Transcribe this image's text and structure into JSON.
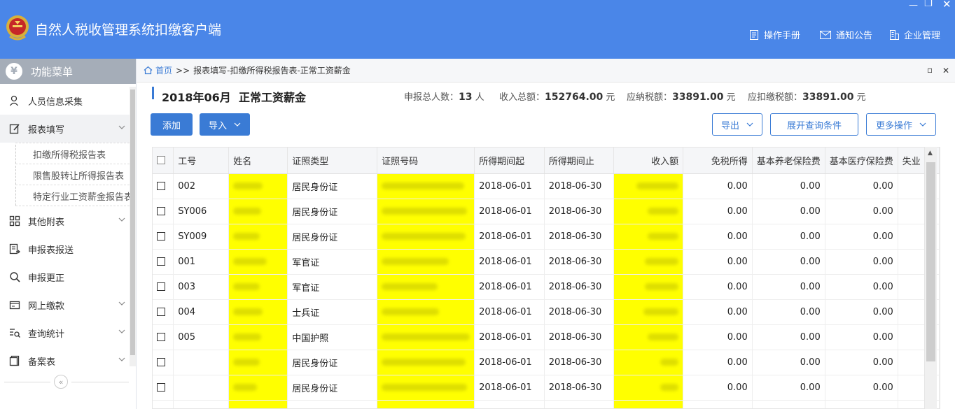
{
  "app": {
    "title": "自然人税收管理系统扣缴客户端"
  },
  "header_menu": [
    {
      "label": "操作手册",
      "icon": "manual-icon"
    },
    {
      "label": "通知公告",
      "icon": "mail-icon"
    },
    {
      "label": "企业管理",
      "icon": "building-icon"
    }
  ],
  "sidebar": {
    "title": "功能菜单",
    "items": [
      {
        "label": "人员信息采集",
        "icon": "person-icon"
      },
      {
        "label": "报表填写",
        "icon": "edit-icon",
        "expanded": true,
        "children": [
          "扣缴所得税报告表",
          "限售股转让所得报告表",
          "特定行业工资薪金报告表"
        ]
      },
      {
        "label": "其他附表",
        "icon": "grid-icon"
      },
      {
        "label": "申报表报送",
        "icon": "report-send-icon"
      },
      {
        "label": "申报更正",
        "icon": "search-icon"
      },
      {
        "label": "网上缴款",
        "icon": "wallet-icon"
      },
      {
        "label": "查询统计",
        "icon": "query-icon"
      },
      {
        "label": "备案表",
        "icon": "file-icon"
      }
    ],
    "collapse_symbol": "«"
  },
  "breadcrumb": {
    "home": "首页",
    "separator": ">>",
    "path": "报表填写-扣缴所得税报告表-正常工资薪金"
  },
  "summary": {
    "period": "2018年06月  正常工资薪金",
    "total_people_label": "申报总人数：",
    "total_people_value": "13",
    "total_people_unit": "人",
    "income_total_label": "收入总额：",
    "income_total_value": "152764.00",
    "income_total_unit": "元",
    "tax_payable_label": "应纳税额：",
    "tax_payable_value": "33891.00",
    "tax_payable_unit": "元",
    "tax_withhold_label": "应扣缴税额：",
    "tax_withhold_value": "33891.00",
    "tax_withhold_unit": "元"
  },
  "toolbar": {
    "add": "添加",
    "import": "导入",
    "export": "导出",
    "expand_query": "展开查询条件",
    "more": "更多操作"
  },
  "table": {
    "columns": [
      "工号",
      "姓名",
      "证照类型",
      "证照号码",
      "所得期间起",
      "所得期间止",
      "收入额",
      "免税所得",
      "基本养老保险费",
      "基本医疗保险费",
      "失业"
    ],
    "rows": [
      {
        "id": "002",
        "cert_type": "居民身份证",
        "start": "2018-06-01",
        "end": "2018-06-30",
        "tax_free": "0.00",
        "pension": "0.00",
        "medical": "0.00"
      },
      {
        "id": "SY006",
        "cert_type": "居民身份证",
        "start": "2018-06-01",
        "end": "2018-06-30",
        "tax_free": "0.00",
        "pension": "0.00",
        "medical": "0.00"
      },
      {
        "id": "SY009",
        "cert_type": "居民身份证",
        "start": "2018-06-01",
        "end": "2018-06-30",
        "tax_free": "0.00",
        "pension": "0.00",
        "medical": "0.00"
      },
      {
        "id": "001",
        "cert_type": "军官证",
        "start": "2018-06-01",
        "end": "2018-06-30",
        "tax_free": "0.00",
        "pension": "0.00",
        "medical": "0.00"
      },
      {
        "id": "003",
        "cert_type": "军官证",
        "start": "2018-06-01",
        "end": "2018-06-30",
        "tax_free": "0.00",
        "pension": "0.00",
        "medical": "0.00"
      },
      {
        "id": "004",
        "cert_type": "士兵证",
        "start": "2018-06-01",
        "end": "2018-06-30",
        "tax_free": "0.00",
        "pension": "0.00",
        "medical": "0.00"
      },
      {
        "id": "005",
        "cert_type": "中国护照",
        "start": "2018-06-01",
        "end": "2018-06-30",
        "tax_free": "0.00",
        "pension": "0.00",
        "medical": "0.00"
      },
      {
        "id": "",
        "cert_type": "居民身份证",
        "start": "2018-06-01",
        "end": "2018-06-30",
        "tax_free": "0.00",
        "pension": "0.00",
        "medical": "0.00"
      },
      {
        "id": "",
        "cert_type": "居民身份证",
        "start": "2018-06-01",
        "end": "2018-06-30",
        "tax_free": "0.00",
        "pension": "0.00",
        "medical": "0.00"
      }
    ]
  },
  "colors": {
    "titlebar": "#4a86e8",
    "accent": "#3a7bd5",
    "highlight": "#ffff00"
  }
}
